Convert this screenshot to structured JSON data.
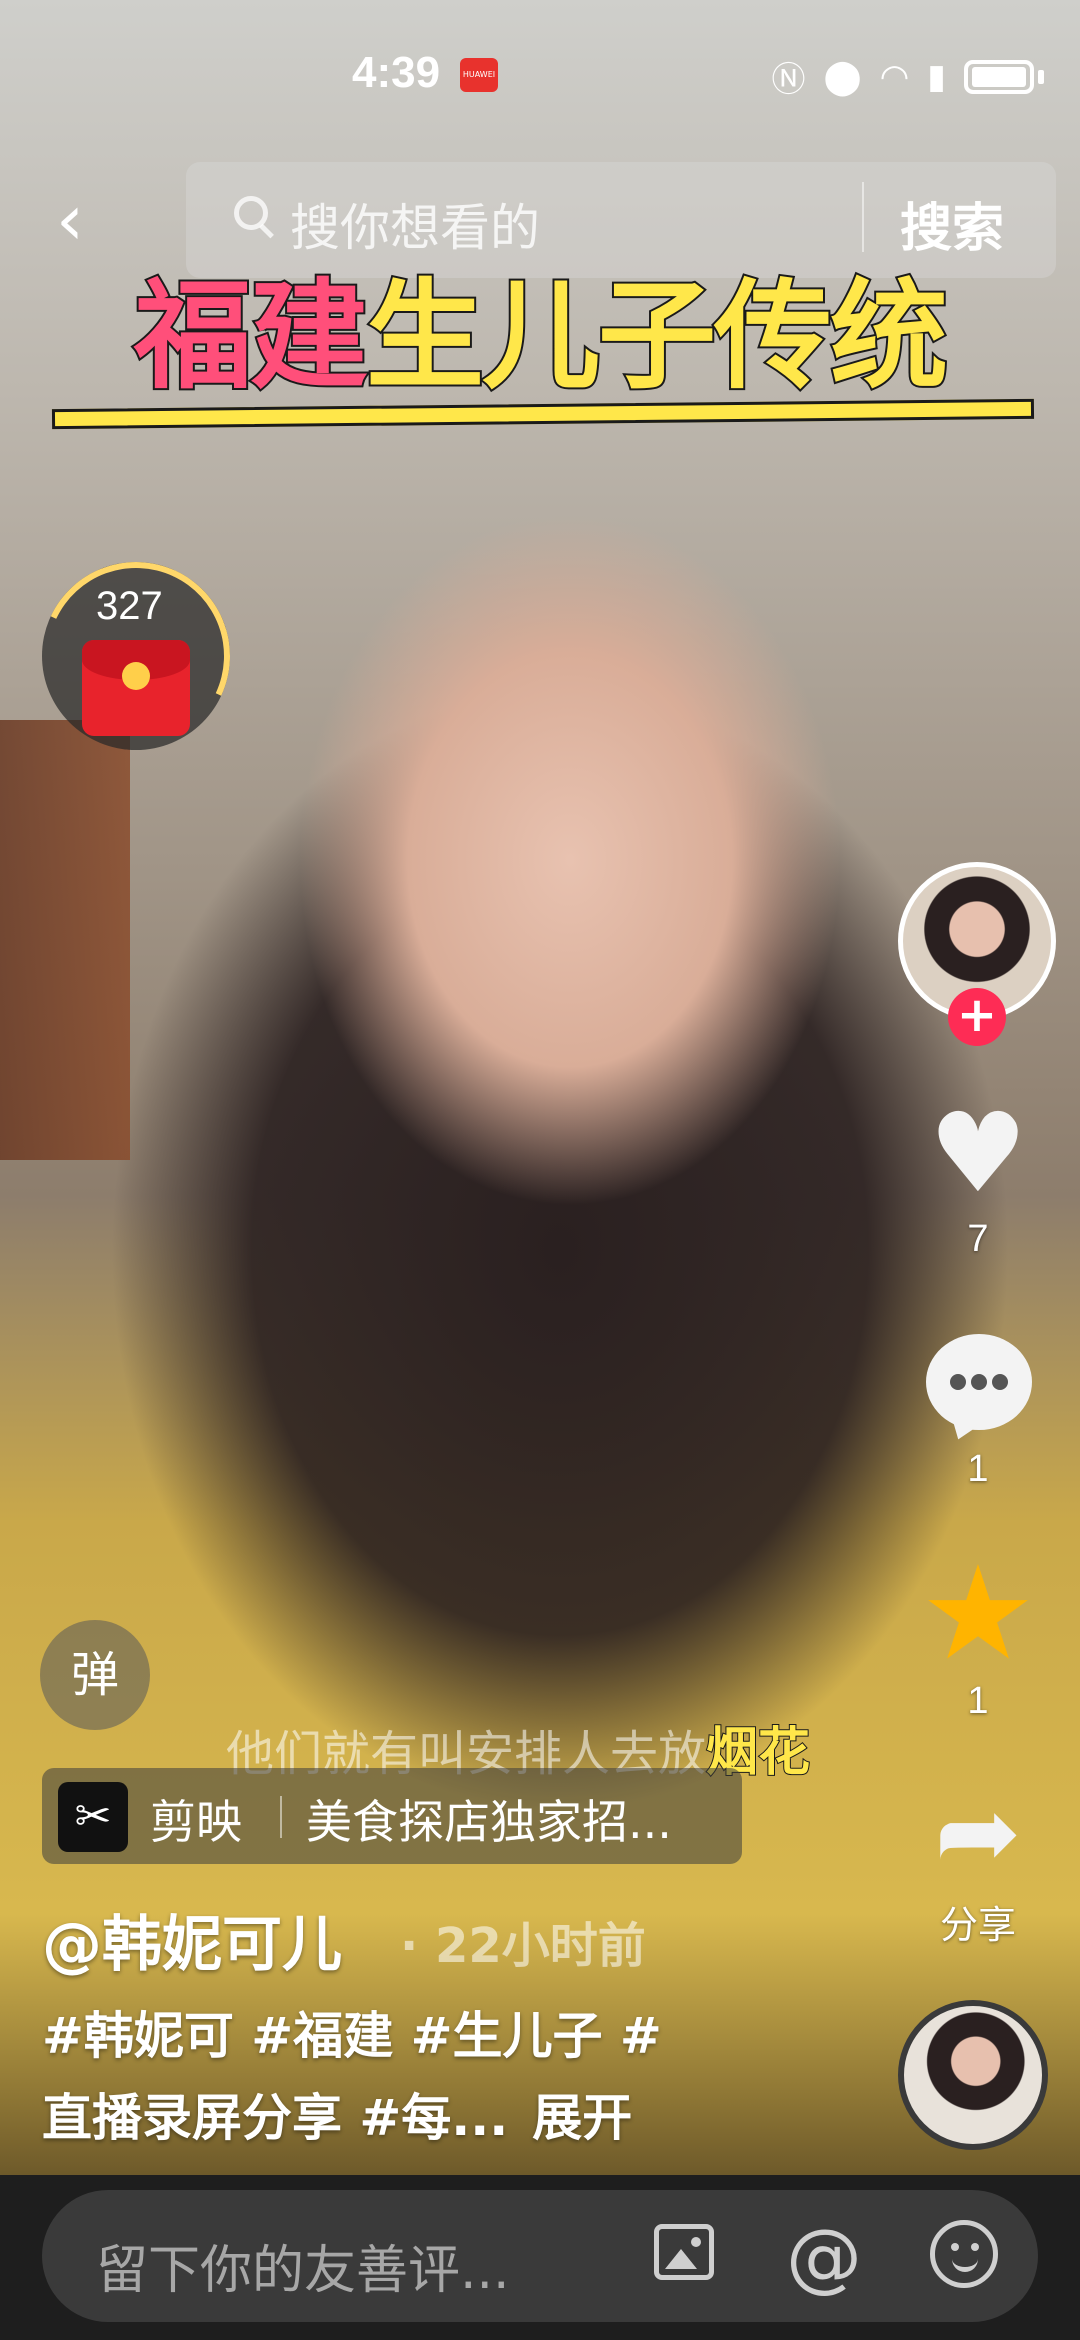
{
  "status_bar": {
    "time": "4:39",
    "badge": "HUAWEI",
    "icons": [
      "nfc-icon",
      "location-icon",
      "wifi-icon",
      "alert-icon",
      "battery-icon"
    ]
  },
  "search": {
    "placeholder": "搜你想看的",
    "button": "搜索"
  },
  "video": {
    "title_part1": "福建",
    "title_part2": "生儿子传统",
    "subtitle_prefix": "他们就有叫安排人去放",
    "subtitle_highlight": "烟花"
  },
  "red_packet": {
    "count": "327"
  },
  "actions": {
    "like_count": "7",
    "comment_count": "1",
    "favorite_count": "1",
    "share_label": "分享",
    "follow_symbol": "+"
  },
  "danmu": {
    "label": "弹"
  },
  "capcut": {
    "app": "剪映",
    "text": "美食探店独家招..."
  },
  "post": {
    "author": "@韩妮可儿",
    "time": "· 22小时前",
    "caption_line1": "#韩妮可 #福建 #生儿子 #",
    "caption_line2": "直播录屏分享 #每...",
    "expand": "展开"
  },
  "comment_bar": {
    "placeholder": "留下你的友善评..."
  },
  "colors": {
    "accent_pink": "#fe2c55",
    "favorite_yellow": "#ffb400",
    "title_yellow": "#ffe74a",
    "title_pink": "#ff4f7a"
  }
}
